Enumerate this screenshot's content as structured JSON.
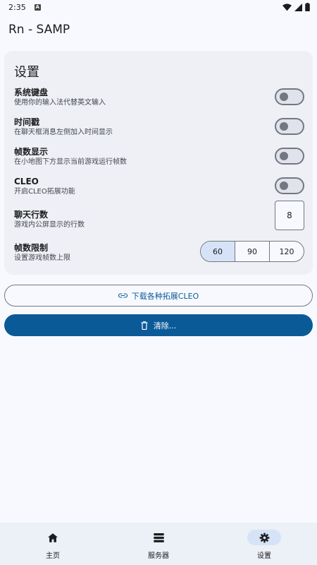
{
  "status": {
    "time": "2:35",
    "notif_letter": "A"
  },
  "app": {
    "title": "Rn - SAMP"
  },
  "settings": {
    "title": "设置",
    "rows": [
      {
        "title": "系统键盘",
        "sub": "使用你的输入法代替英文输入",
        "control": "switch",
        "on": false
      },
      {
        "title": "时间戳",
        "sub": "在聊天框消息左侧加入时间显示",
        "control": "switch",
        "on": false
      },
      {
        "title": "帧数显示",
        "sub": "在小地图下方显示当前游戏运行帧数",
        "control": "switch",
        "on": false
      },
      {
        "title": "CLEO",
        "sub": "开启CLEO拓展功能",
        "control": "switch",
        "on": false
      },
      {
        "title": "聊天行数",
        "sub": "游戏内公屏显示的行数",
        "control": "number",
        "value": "8"
      },
      {
        "title": "帧数限制",
        "sub": "设置游戏帧数上限",
        "control": "segmented",
        "options": [
          "60",
          "90",
          "120"
        ],
        "selected": "60"
      }
    ]
  },
  "buttons": {
    "download_cleo": "下载各种拓展CLEO",
    "clear": "清除..."
  },
  "nav": {
    "items": [
      {
        "label": "主页",
        "icon": "home-icon"
      },
      {
        "label": "服务器",
        "icon": "server-icon"
      },
      {
        "label": "设置",
        "icon": "gear-icon",
        "active": true
      }
    ]
  },
  "colors": {
    "primary": "#0b5a98",
    "surface": "#f8f9ff",
    "card": "#eef0f6",
    "selected": "#d6e3f7"
  }
}
